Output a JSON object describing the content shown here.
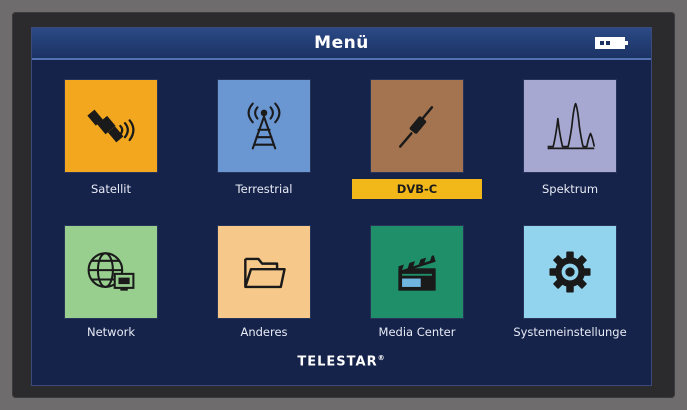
{
  "header": {
    "title": "Menü"
  },
  "brand": {
    "name": "TELESTAR",
    "mark": "®"
  },
  "menu": {
    "items": [
      {
        "label": "Satellit",
        "icon": "satellite-icon",
        "color": "#f2a71e"
      },
      {
        "label": "Terrestrial",
        "icon": "antenna-tower-icon",
        "color": "#6a96d2"
      },
      {
        "label": "DVB-C",
        "icon": "coax-cable-icon",
        "color": "#a3744f",
        "selected": true
      },
      {
        "label": "Spektrum",
        "icon": "spectrum-icon",
        "color": "#a7a8d1"
      },
      {
        "label": "Network",
        "icon": "network-globe-icon",
        "color": "#98cf8f"
      },
      {
        "label": "Anderes",
        "icon": "folder-icon",
        "color": "#f6c88a"
      },
      {
        "label": "Media Center",
        "icon": "clapperboard-icon",
        "color": "#1f8f6a"
      },
      {
        "label": "Systemeinstellunge",
        "icon": "gear-icon",
        "color": "#92d4ee"
      }
    ]
  },
  "colors": {
    "screen_bg": "#15224a",
    "titlebar": "#1b3264",
    "selection": "#f2b81a"
  }
}
